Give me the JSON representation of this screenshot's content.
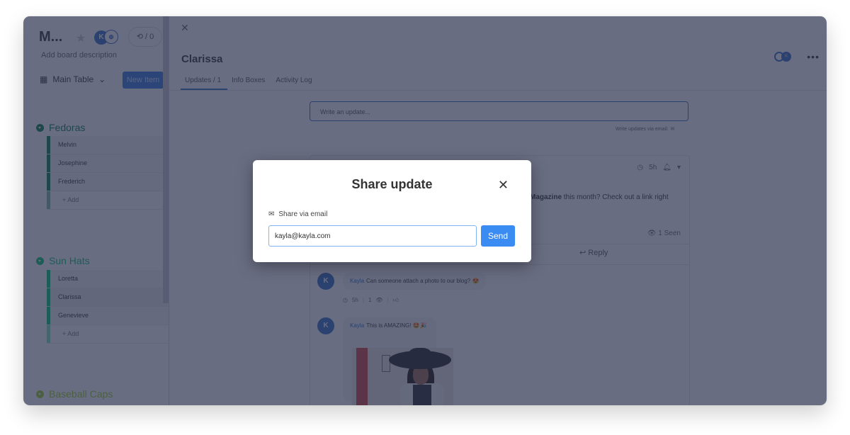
{
  "board": {
    "title": "M...",
    "description": "Add board description",
    "activity": "/ 0",
    "avatar_initial": "K",
    "view_label": "Main Table",
    "new_item_label": "New Item",
    "groups": [
      {
        "name": "Fedoras",
        "color": "#037f4c",
        "items": [
          "Melvin",
          "Josephine",
          "Frederich"
        ],
        "add_label": "+ Add"
      },
      {
        "name": "Sun Hats",
        "color": "#00c875",
        "items": [
          "Loretta",
          "Clarissa",
          "Genevieve"
        ],
        "add_label": "+ Add",
        "selected": "Clarissa"
      },
      {
        "name": "Baseball Caps",
        "color": "#9cd326",
        "items": [],
        "add_label": ""
      }
    ]
  },
  "item_panel": {
    "title": "Clarissa",
    "tabs": [
      {
        "label": "Updates / 1",
        "active": true
      },
      {
        "label": "Info Boxes",
        "active": false
      },
      {
        "label": "Activity Log",
        "active": false
      }
    ],
    "subscriber_initial": "K",
    "update_placeholder": "Write an update...",
    "via_email_label": "Write updates via email:",
    "post": {
      "time": "5h",
      "text_bold": "Magazine",
      "text_rest": " this month? Check out a link right",
      "seen": "1 Seen",
      "reply_label": "Reply"
    },
    "comments": [
      {
        "author": "Kayla",
        "initial": "K",
        "text": "Can someone attach a photo to our blog? 😍",
        "time": "5h",
        "views": "1"
      },
      {
        "author": "Kayla",
        "initial": "K",
        "text": "This is AMAZING! 🤩🎉"
      }
    ]
  },
  "modal": {
    "title": "Share update",
    "label": "Share via email",
    "email_value": "kayla@kayla.com",
    "send_label": "Send"
  },
  "colors": {
    "accent": "#2f6cc4",
    "send_button": "#3a8cf2",
    "overlay": "#6b6f82"
  }
}
